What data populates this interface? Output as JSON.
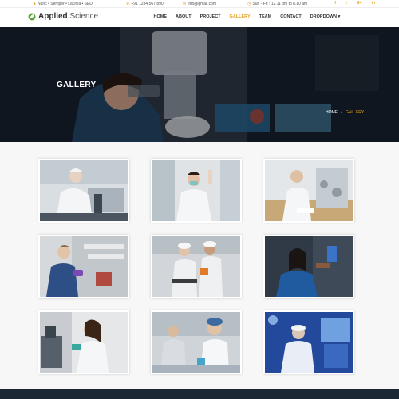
{
  "topbar": {
    "address": "Nunc • Semper • Lacinia • SED",
    "phone": "+91 1234 567 890",
    "email": "info@gmail.com",
    "hours": "Sun - Fri : 12.11 pm to 8.10 am",
    "socials": [
      {
        "icon": "facebook-icon",
        "glyph": "f"
      },
      {
        "icon": "twitter-icon",
        "glyph": "t"
      },
      {
        "icon": "google-plus-icon",
        "glyph": "G+"
      },
      {
        "icon": "linkedin-icon",
        "glyph": "in"
      }
    ]
  },
  "logo": {
    "brand": "Applied",
    "suffix": " Science"
  },
  "nav": {
    "items": [
      {
        "label": "Home"
      },
      {
        "label": "About"
      },
      {
        "label": "Project"
      },
      {
        "label": "Gallery"
      },
      {
        "label": "Team"
      },
      {
        "label": "Contact"
      },
      {
        "label": "Dropdown ▾"
      }
    ],
    "active_index": 3
  },
  "hero": {
    "title": "GALLERY"
  },
  "breadcrumb": {
    "home": "HOME",
    "separator": "/",
    "current": "GALLERY"
  },
  "colors": {
    "accent": "#e8a319",
    "dark": "#1b2732"
  }
}
